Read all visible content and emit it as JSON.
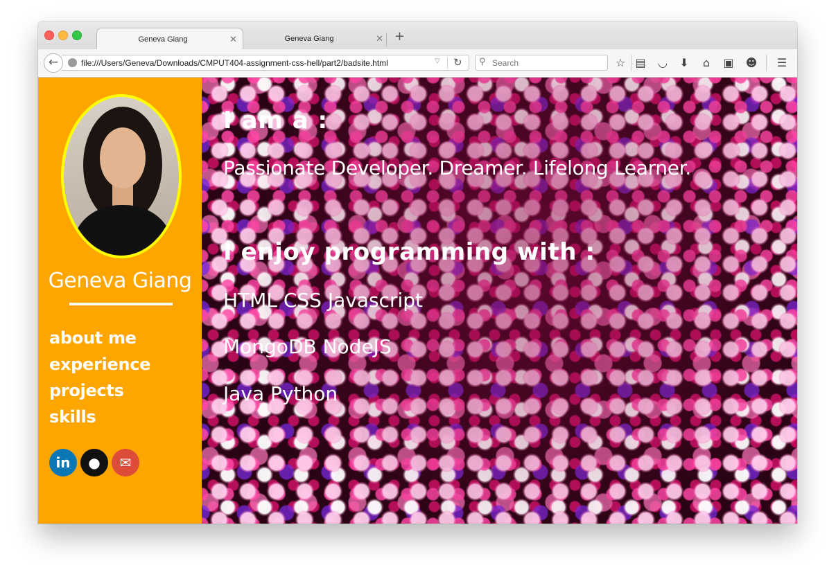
{
  "browser": {
    "tabs": [
      {
        "title": "Geneva Giang",
        "active": true
      },
      {
        "title": "Geneva Giang",
        "active": false
      }
    ],
    "tab_close_glyph": "✕",
    "new_tab_glyph": "+",
    "url": "file:///Users/Geneva/Downloads/CMPUT404-assignment-css-hell/part2/badsite.html",
    "search_placeholder": "Search",
    "toolbar_icons": [
      "bookmark-star-icon",
      "reading-list-icon",
      "pocket-icon",
      "download-icon",
      "home-icon",
      "screenshot-icon",
      "emoji-icon",
      "hamburger-menu-icon"
    ]
  },
  "sidebar": {
    "name": "Geneva Giang",
    "nav_items": [
      "about me",
      "experience",
      "projects",
      "skills"
    ],
    "social": [
      {
        "name": "linkedin-icon",
        "glyph": "in",
        "color": "#0b77b5"
      },
      {
        "name": "github-icon",
        "glyph": "●",
        "color": "#111111"
      },
      {
        "name": "email-icon",
        "glyph": "✉",
        "color": "#dd4b39"
      }
    ],
    "background": "#ffa500",
    "avatar_border": "#ffff00"
  },
  "main": {
    "heading1": "I am a :",
    "tagline": "Passionate Developer. Dreamer. Lifelong Learner.",
    "heading2": "I enjoy programming with :",
    "skills": [
      "HTML CSS Javascript",
      "MongoDB NodeJS",
      "Java Python"
    ]
  }
}
